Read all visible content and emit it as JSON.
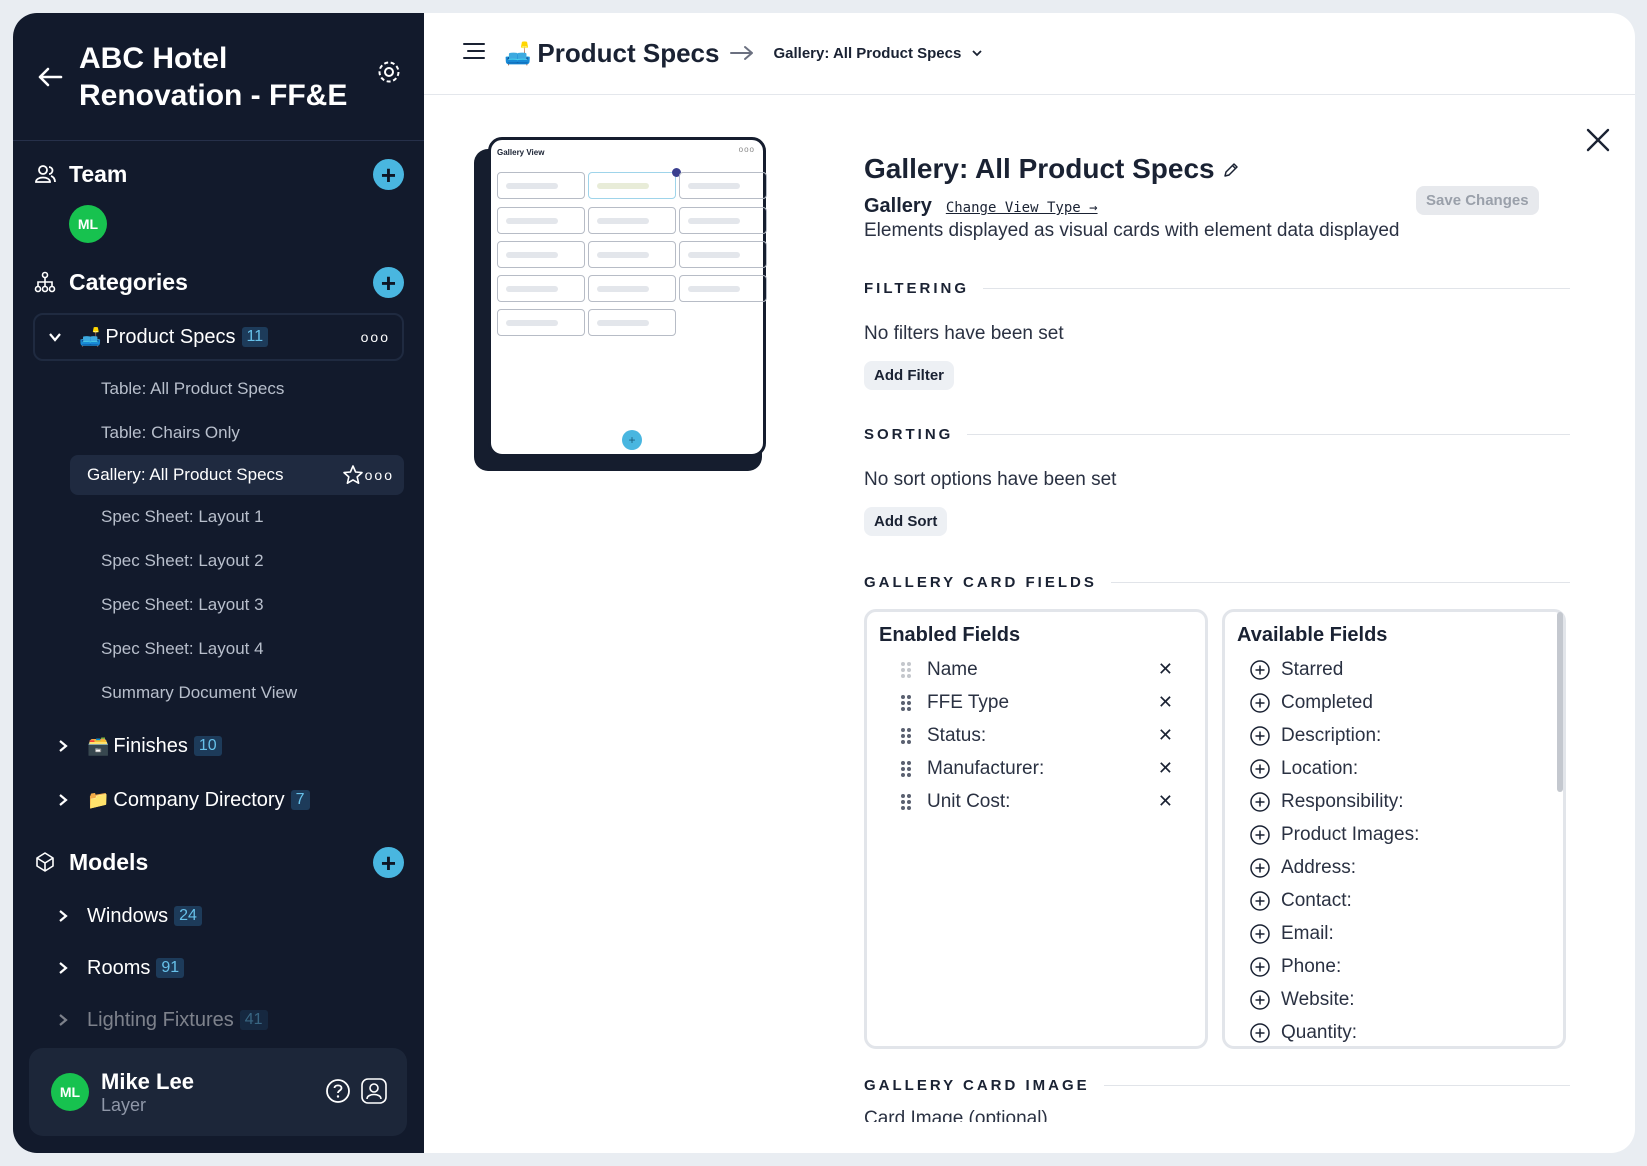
{
  "sidebar": {
    "project_title": "ABC Hotel Renovation - FF&E",
    "team": {
      "label": "Team",
      "member_initials": "ML"
    },
    "categories": {
      "label": "Categories",
      "product_specs": {
        "emoji": "🛋️",
        "label": "Product Specs",
        "count": "11",
        "views": [
          "Table: All Product Specs",
          "Table: Chairs Only",
          "Gallery: All Product Specs",
          "Spec Sheet: Layout 1",
          "Spec Sheet: Layout 2",
          "Spec Sheet: Layout 3",
          "Spec Sheet: Layout 4",
          "Summary Document View"
        ]
      },
      "finishes": {
        "emoji": "🗃️",
        "label": "Finishes",
        "count": "10"
      },
      "company_directory": {
        "emoji": "📁",
        "label": "Company Directory",
        "count": "7"
      }
    },
    "models": {
      "label": "Models",
      "items": [
        {
          "label": "Windows",
          "count": "24"
        },
        {
          "label": "Rooms",
          "count": "91"
        },
        {
          "label": "Lighting Fixtures",
          "count": "41"
        }
      ]
    },
    "user": {
      "initials": "ML",
      "name": "Mike Lee",
      "org": "Layer"
    }
  },
  "topbar": {
    "emoji": "🛋️",
    "category": "Product Specs",
    "view": "Gallery: All Product Specs"
  },
  "preview": {
    "title": "Gallery View"
  },
  "panel": {
    "title": "Gallery: All Product Specs",
    "save_label": "Save Changes",
    "view_type": "Gallery",
    "change_type_label": "Change View Type →",
    "description": "Elements displayed as visual cards with element data displayed",
    "filtering": {
      "label": "FILTERING",
      "message": "No filters have been set",
      "button": "Add Filter"
    },
    "sorting": {
      "label": "SORTING",
      "message": "No sort options have been set",
      "button": "Add Sort"
    },
    "card_fields": {
      "label": "GALLERY CARD FIELDS",
      "enabled_title": "Enabled Fields",
      "enabled": [
        "Name",
        "FFE Type",
        "Status:",
        "Manufacturer:",
        "Unit Cost:"
      ],
      "available_title": "Available Fields",
      "available": [
        "Starred",
        "Completed",
        "Description:",
        "Location:",
        "Responsibility:",
        "Product Images:",
        "Address:",
        "Contact:",
        "Email:",
        "Phone:",
        "Website:",
        "Quantity:"
      ]
    },
    "card_image": {
      "label": "GALLERY CARD IMAGE",
      "sub_label": "Card Image (optional)"
    }
  },
  "colors": {
    "sidebar_bg": "#121a2c",
    "accent": "#49b6e0",
    "avatar": "#17c24f"
  }
}
